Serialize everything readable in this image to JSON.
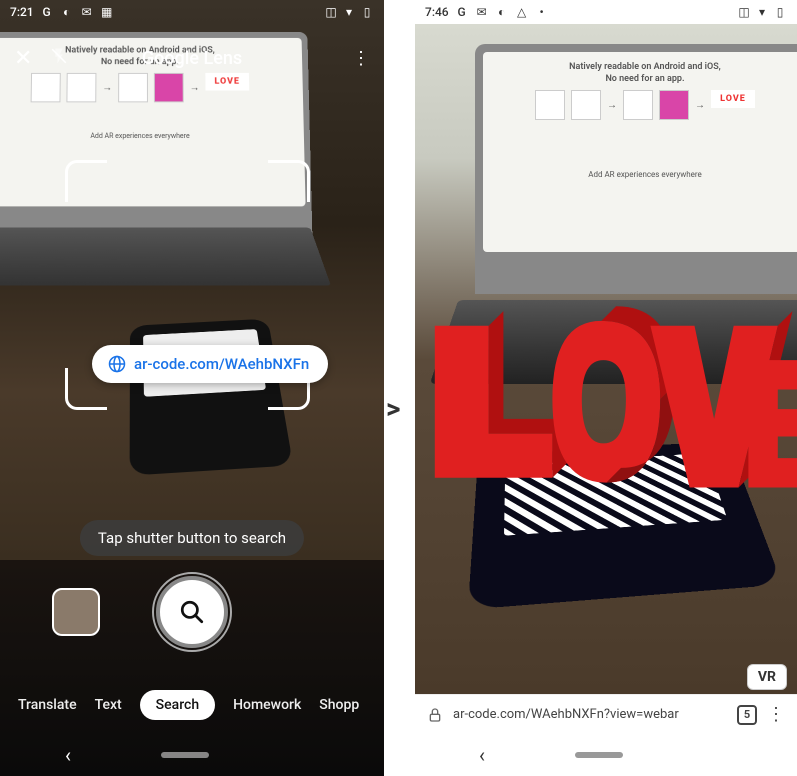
{
  "left": {
    "statusbar": {
      "time": "7:21"
    },
    "header": {
      "title": "Google Lens"
    },
    "result": {
      "url": "ar-code.com/WAehbNXFn"
    },
    "hint": "Tap shutter button to search",
    "tabs": {
      "translate": "Translate",
      "text": "Text",
      "search": "Search",
      "homework": "Homework",
      "shopping": "Shopp"
    },
    "laptop": {
      "heading1": "Natively readable on Android and iOS,",
      "heading2": "No need for an app.",
      "love": "LOVE",
      "footer": "Add AR experiences everywhere"
    }
  },
  "right": {
    "statusbar": {
      "time": "7:46"
    },
    "vr_badge": "VR",
    "addrbar": {
      "url": "ar-code.com/WAehbNXFn?view=webar",
      "tab_count": "5"
    },
    "laptop": {
      "heading1": "Natively readable on Android and iOS,",
      "heading2": "No need for an app.",
      "love": "LOVE",
      "footer": "Add AR experiences everywhere"
    }
  },
  "divider": ">"
}
